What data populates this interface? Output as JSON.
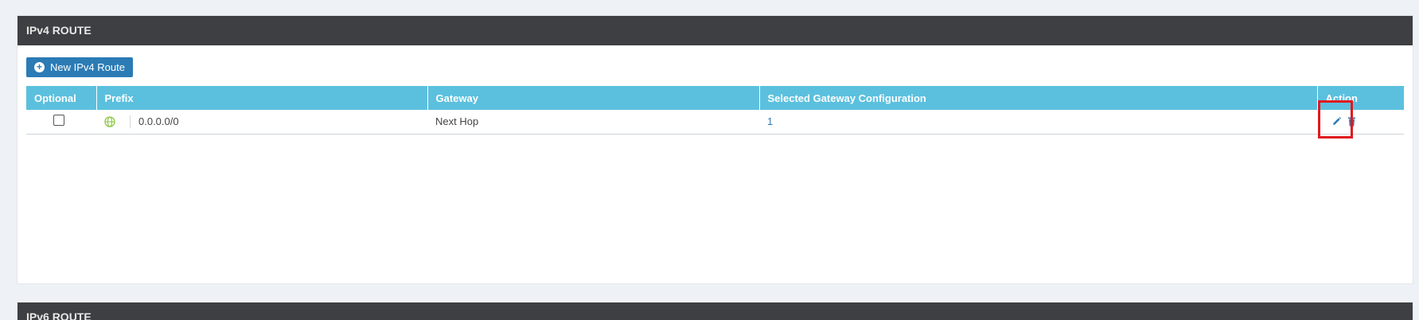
{
  "ipv4_panel": {
    "title": "IPv4 ROUTE",
    "new_button_label": "New IPv4 Route",
    "columns": [
      "Optional",
      "Prefix",
      "Gateway",
      "Selected Gateway Configuration",
      "Action"
    ],
    "rows": [
      {
        "optional_checked": false,
        "prefix": "0.0.0.0/0",
        "gateway": "Next Hop",
        "selected_gateway_configuration": "1"
      }
    ]
  },
  "ipv6_panel": {
    "title": "IPv6 ROUTE"
  },
  "colors": {
    "header_bg": "#3e3f42",
    "table_header_bg": "#5bc0de",
    "button_bg": "#2b7bb5",
    "link": "#2b7bb5",
    "highlight": "#e0191f",
    "globe": "#8cc63f"
  },
  "icons": {
    "new_button": "plus-circle-icon",
    "prefix": "globe-icon",
    "edit": "pencil-icon",
    "delete": "trash-icon"
  }
}
